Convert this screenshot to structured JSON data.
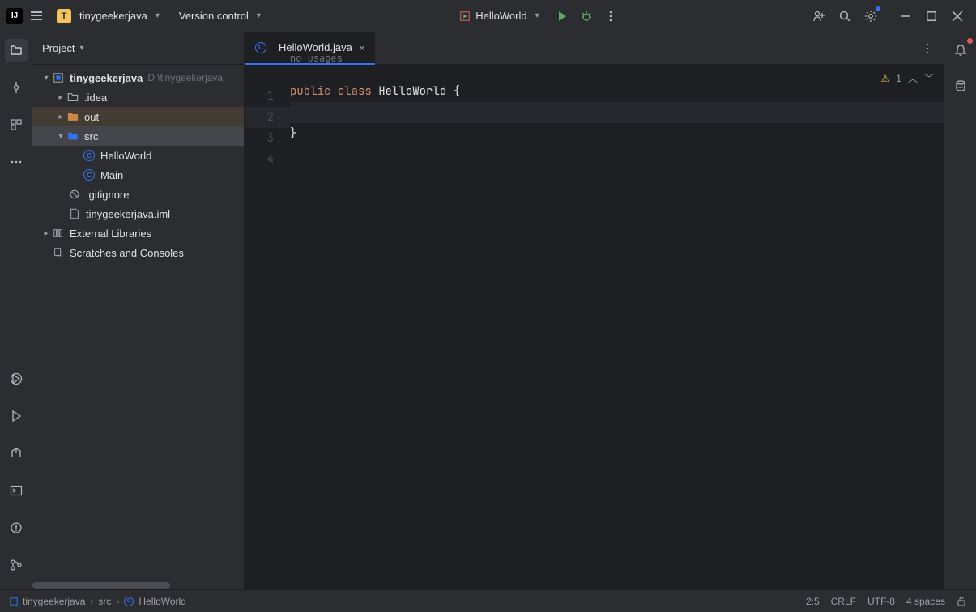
{
  "titlebar": {
    "app_initial": "IJ",
    "project_badge": "T",
    "project_name": "tinygeekerjava",
    "version_control": "Version control",
    "run_config": "HelloWorld"
  },
  "panel": {
    "title": "Project"
  },
  "tree": {
    "root_name": "tinygeekerjava",
    "root_path": "D:\\tinygeekerjava",
    "idea": ".idea",
    "out": "out",
    "src": "src",
    "hello": "HelloWorld",
    "main": "Main",
    "gitignore": ".gitignore",
    "iml": "tinygeekerjava.iml",
    "ext_libs": "External Libraries",
    "scratches": "Scratches and Consoles"
  },
  "tab": {
    "name": "HelloWorld.java"
  },
  "editor": {
    "code_lens": "no usages",
    "kw_public": "public",
    "kw_class": "class",
    "class_name": "HelloWorld",
    "open_brace": "{",
    "close_brace": "}",
    "line_numbers": [
      "1",
      "2",
      "3",
      "4"
    ],
    "warn_count": "1"
  },
  "breadcrumbs": {
    "b1": "tinygeekerjava",
    "b2": "src",
    "b3": "HelloWorld"
  },
  "status": {
    "pos": "2:5",
    "line_sep": "CRLF",
    "encoding": "UTF-8",
    "indent": "4 spaces"
  }
}
